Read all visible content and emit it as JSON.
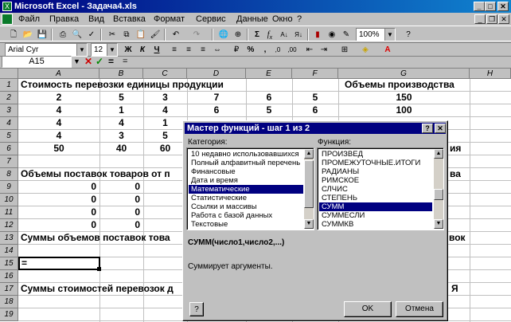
{
  "window": {
    "title": "Microsoft Excel - Задача4.xls"
  },
  "menu": [
    "Файл",
    "Правка",
    "Вид",
    "Вставка",
    "Формат",
    "Сервис",
    "Данные",
    "Окно",
    "?"
  ],
  "toolbar": {
    "zoom": "100%",
    "font": "Arial Cyr",
    "size": "12"
  },
  "formula": {
    "cell_ref": "A15",
    "content": "="
  },
  "columns": [
    "A",
    "B",
    "C",
    "D",
    "E",
    "F",
    "G",
    "H"
  ],
  "rows": [
    "1",
    "2",
    "3",
    "4",
    "5",
    "6",
    "7",
    "8",
    "9",
    "10",
    "11",
    "12",
    "13",
    "14",
    "15",
    "16",
    "17",
    "18",
    "19"
  ],
  "cells": {
    "r1a": "Стоимость перевозки единицы продукции",
    "r1g": "Объемы производства",
    "r2": [
      "2",
      "5",
      "3",
      "7",
      "6",
      "5",
      "150"
    ],
    "r3": [
      "4",
      "1",
      "4",
      "6",
      "5",
      "6",
      "100"
    ],
    "r4": [
      "4",
      "4",
      "1"
    ],
    "r5": [
      "4",
      "3",
      "5"
    ],
    "r6": [
      "50",
      "40",
      "60"
    ],
    "r6g": "ия",
    "r8a": "Объемы поставок товаров от п",
    "r8g": "ва",
    "r9": [
      "0",
      "0"
    ],
    "r10": [
      "0",
      "0"
    ],
    "r11": [
      "0",
      "0"
    ],
    "r12": [
      "0",
      "0"
    ],
    "r13a": "Суммы объемов поставок това",
    "r13g": "вок",
    "r15a": "=",
    "r17a": "Суммы стоимостей перевозок д",
    "r17g": "Я"
  },
  "dialog": {
    "title": "Мастер функций - шаг 1 из 2",
    "help_btn": "?",
    "close_btn": "✕",
    "category_label": "Категория:",
    "function_label": "Функция:",
    "categories": [
      "10 недавно использовавшихся",
      "Полный алфавитный перечень",
      "Финансовые",
      "Дата и время",
      "Математические",
      "Статистические",
      "Ссылки и массивы",
      "Работа с базой данных",
      "Текстовые"
    ],
    "selected_category": "Математические",
    "functions": [
      "ПРОИЗВЕД",
      "ПРОМЕЖУТОЧНЫЕ.ИТОГИ",
      "РАДИАНЫ",
      "РИМСКОЕ",
      "СЛЧИС",
      "СТЕПЕНЬ",
      "СУММ",
      "СУММЕСЛИ",
      "СУММКВ"
    ],
    "selected_function": "СУММ",
    "signature": "СУММ(число1,число2,...)",
    "description": "Суммирует аргументы.",
    "ok": "OK",
    "cancel": "Отмена",
    "assistant": "?"
  }
}
